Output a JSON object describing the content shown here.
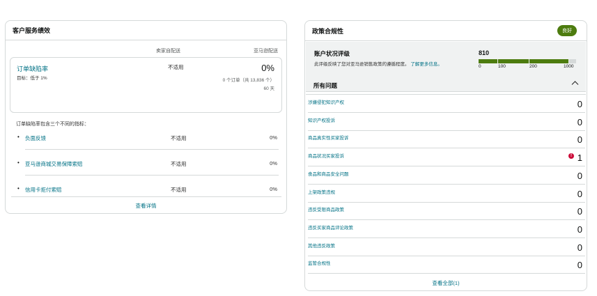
{
  "customer_service": {
    "title": "客户服务绩效",
    "col_seller": "卖家自配送",
    "col_amazon": "亚马逊配送",
    "odr": {
      "title": "订单缺陷率",
      "target": "目标：低于 1%",
      "seller_value": "不适用",
      "amazon_pct": "0%",
      "amazon_orders": "0 个订单（共 13,836 个）",
      "amazon_days": "60 天"
    },
    "metrics_intro": "订单缺陷率包含三个不同的指标：",
    "metrics": [
      {
        "label": "负面反馈",
        "seller": "不适用",
        "amazon": "0%"
      },
      {
        "label": "亚马逊商城交易保障索赔",
        "seller": "不适用",
        "amazon": "0%"
      },
      {
        "label": "信用卡拒付索赔",
        "seller": "不适用",
        "amazon": "0%"
      }
    ],
    "footer_link": "查看详情"
  },
  "policy_compliance": {
    "title": "政策合规性",
    "badge": "良好",
    "badge_color": "#4d7c0f",
    "account_health": {
      "title": "账户状况评级",
      "description": "此评级反映了您对亚马逊销售政策的遵循程度。",
      "learn_more": "了解更多信息。",
      "score": "810",
      "bar_ticks": [
        "0",
        "100",
        "200",
        "1000"
      ],
      "bar_color": "#4d7c0f"
    },
    "issues_title": "所有问题",
    "issues": [
      {
        "label": "涉嫌侵犯知识产权",
        "count": "0",
        "alert": false
      },
      {
        "label": "知识产权投诉",
        "count": "0",
        "alert": false
      },
      {
        "label": "商品真实性买家投诉",
        "count": "0",
        "alert": false
      },
      {
        "label": "商品状况买家投诉",
        "count": "1",
        "alert": true
      },
      {
        "label": "食品和商品安全问题",
        "count": "0",
        "alert": false
      },
      {
        "label": "上架政策违规",
        "count": "0",
        "alert": false
      },
      {
        "label": "违反受限商品政策",
        "count": "0",
        "alert": false
      },
      {
        "label": "违反买家商品评论政策",
        "count": "0",
        "alert": false
      },
      {
        "label": "其他违反政策",
        "count": "0",
        "alert": false
      },
      {
        "label": "监管合规性",
        "count": "0",
        "alert": false
      }
    ],
    "footer_link": "查看全部(1)"
  }
}
